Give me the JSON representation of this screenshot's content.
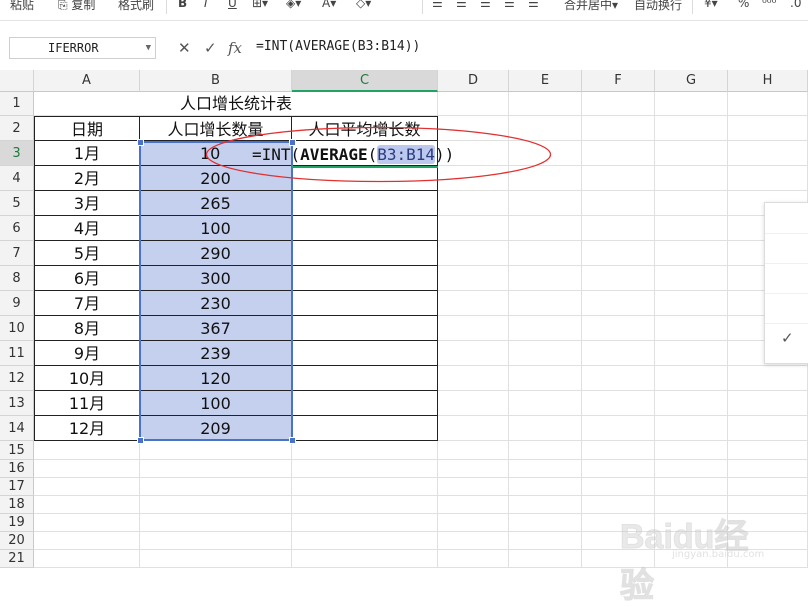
{
  "ribbon": {
    "paste": "粘贴",
    "copy": "复制",
    "format_painter": "格式刷",
    "bold": "B",
    "italic": "I",
    "underline": "U",
    "merge_center": "合并居中",
    "wrap_text": "自动换行",
    "percent": "%"
  },
  "formula_bar": {
    "name_box": "IFERROR",
    "cancel_icon": "✕",
    "confirm_icon": "✓",
    "fx_label": "fx",
    "formula": "=INT(AVERAGE(B3:B14))"
  },
  "columns": [
    "A",
    "B",
    "C",
    "D",
    "E",
    "F",
    "G",
    "H"
  ],
  "rows": [
    "1",
    "2",
    "3",
    "4",
    "5",
    "6",
    "7",
    "8",
    "9",
    "10",
    "11",
    "12",
    "13",
    "14",
    "15",
    "16",
    "17",
    "18",
    "19",
    "20",
    "21"
  ],
  "sheet": {
    "title": "人口增长统计表",
    "headers": {
      "date": "日期",
      "growth": "人口增长数量",
      "avg_growth": "人口平均增长数"
    },
    "data": [
      {
        "month": "1月",
        "value": "10"
      },
      {
        "month": "2月",
        "value": "200"
      },
      {
        "month": "3月",
        "value": "265"
      },
      {
        "month": "4月",
        "value": "100"
      },
      {
        "month": "5月",
        "value": "290"
      },
      {
        "month": "6月",
        "value": "300"
      },
      {
        "month": "7月",
        "value": "230"
      },
      {
        "month": "8月",
        "value": "367"
      },
      {
        "month": "9月",
        "value": "239"
      },
      {
        "month": "10月",
        "value": "120"
      },
      {
        "month": "11月",
        "value": "100"
      },
      {
        "month": "12月",
        "value": "209"
      }
    ]
  },
  "cell_edit": {
    "prefix": "=INT(",
    "func": "AVERAGE",
    "open": "(",
    "ref": "B3:B14",
    "close": "))"
  },
  "active_column": "C",
  "active_row": "3",
  "colors": {
    "selection_fill": "#c5d0ef",
    "selection_border": "#4a72c8",
    "ellipse": "#e03030",
    "active_header_text": "#1f7a3c"
  },
  "watermark": {
    "logo": "Baidu经验",
    "sub": "jingyan.baidu.com"
  }
}
